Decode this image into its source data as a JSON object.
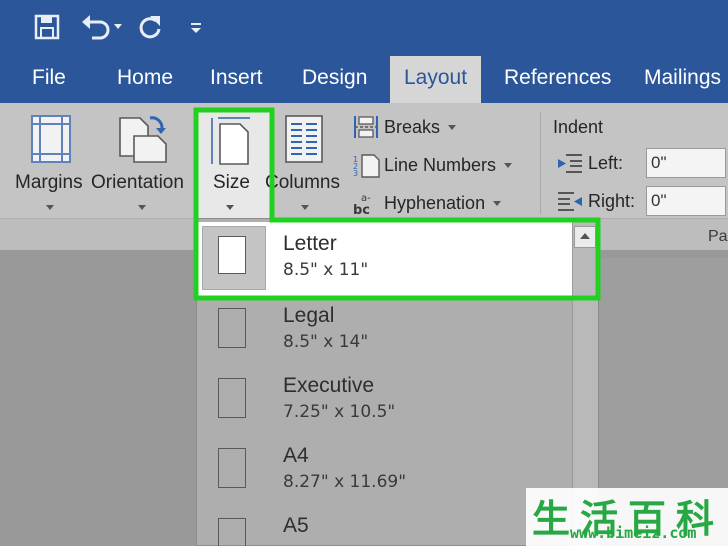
{
  "tabs": [
    {
      "label": "File"
    },
    {
      "label": "Home"
    },
    {
      "label": "Insert"
    },
    {
      "label": "Design"
    },
    {
      "label": "Layout",
      "active": true
    },
    {
      "label": "References"
    },
    {
      "label": "Mailings"
    }
  ],
  "quick_access": [
    "save-icon",
    "undo-icon",
    "redo-icon",
    "customize-icon"
  ],
  "ribbon": {
    "margins_label": "Margins",
    "orientation_label": "Orientation",
    "size_label": "Size",
    "columns_label": "Columns",
    "breaks_label": "Breaks",
    "line_numbers_label": "Line Numbers",
    "hyphenation_label": "Hyphenation",
    "indent": {
      "group_label": "Indent",
      "left_label": "Left:",
      "left_value": "0\"",
      "right_label": "Right:",
      "right_value": "0\""
    },
    "paragraph_group_label": "Pa"
  },
  "size_gallery": {
    "items": [
      {
        "name": "Letter",
        "dims": "8.5\" x 11\"",
        "selected": true
      },
      {
        "name": "Legal",
        "dims": "8.5\" x 14\""
      },
      {
        "name": "Executive",
        "dims": "7.25\" x 10.5\""
      },
      {
        "name": "A4",
        "dims": "8.27\" x 11.69\""
      },
      {
        "name": "A5",
        "dims": ""
      }
    ]
  },
  "watermark": {
    "chars": "生活百科",
    "url": "www.bimeiz.com"
  },
  "colors": {
    "ribbon_blue": "#2b579a",
    "highlight_green": "#22d11f"
  }
}
